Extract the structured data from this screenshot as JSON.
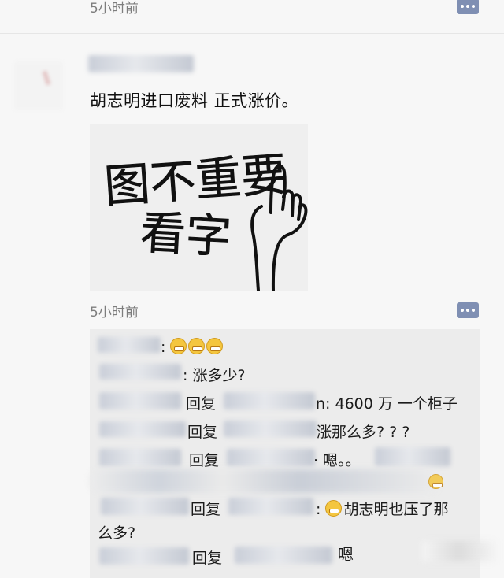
{
  "post": {
    "time_top": "5小时前",
    "text": "胡志明进口废料 正式涨价。",
    "image_text_line1": "图不重要",
    "image_text_line2": "看字",
    "time_bottom": "5小时前"
  },
  "comments": {
    "line1_emoji": "😁😁😁",
    "line2": ": 涨多少?",
    "line3_reply": "回复",
    "line3_text": "n: 4600 万 一个柜子",
    "line4_reply": "回复",
    "line4_text": "涨那么多? ? ?",
    "line5_reply": "回复",
    "line5_text": "· 嗯。。",
    "line7_reply": "回复",
    "line7_text": ":",
    "line7_text_after": "胡志明也压了那",
    "line8": "么多?",
    "line9_reply": "回复",
    "line9_text": "嗯"
  },
  "colors": {
    "page_bg": "#f7f7f7",
    "comment_box_bg": "#ececec",
    "comment_icon": "#7f8fb3",
    "time_text": "#7d7d7d"
  }
}
